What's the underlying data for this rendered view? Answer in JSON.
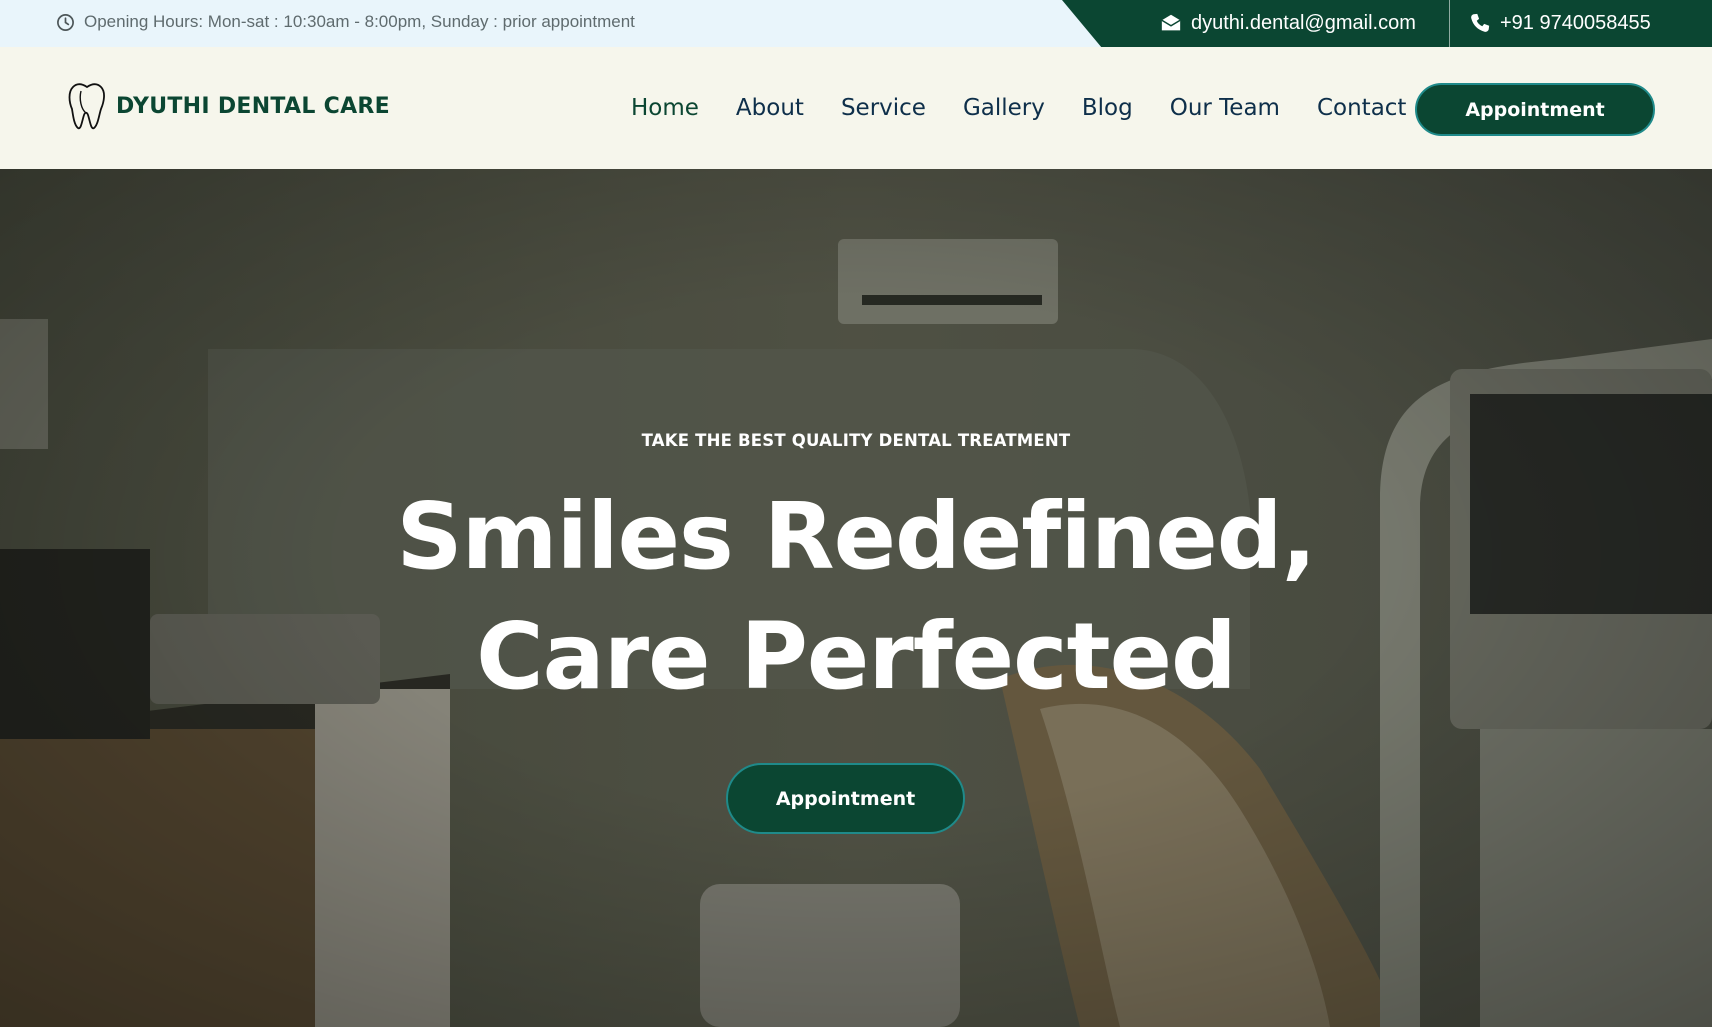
{
  "topbar": {
    "hours_icon": "clock-icon",
    "hours_text": "Opening Hours: Mon-sat : 10:30am - 8:00pm, Sunday : prior appointment",
    "email_icon": "envelope-icon",
    "email": "dyuthi.dental@gmail.com",
    "phone_icon": "phone-icon",
    "phone": "+91 9740058455"
  },
  "header": {
    "logo_icon": "tooth-icon",
    "logo_text": "DYUTHI DENTAL CARE",
    "nav": [
      {
        "label": "Home",
        "active": true
      },
      {
        "label": "About"
      },
      {
        "label": "Service"
      },
      {
        "label": "Gallery"
      },
      {
        "label": "Blog"
      },
      {
        "label": "Our Team"
      },
      {
        "label": "Contact"
      }
    ],
    "cta_label": "Appointment"
  },
  "hero": {
    "eyebrow": "TAKE THE BEST QUALITY DENTAL TREATMENT",
    "headline_line1": "Smiles Redefined,",
    "headline_line2": "Care Perfected",
    "cta_label": "Appointment"
  },
  "colors": {
    "brand_green": "#0b4632",
    "button_border": "#1f8a8a",
    "topbar_bg": "#e9f5fb",
    "header_bg": "#f6f6ec",
    "nav_text": "#0e2f4a"
  }
}
